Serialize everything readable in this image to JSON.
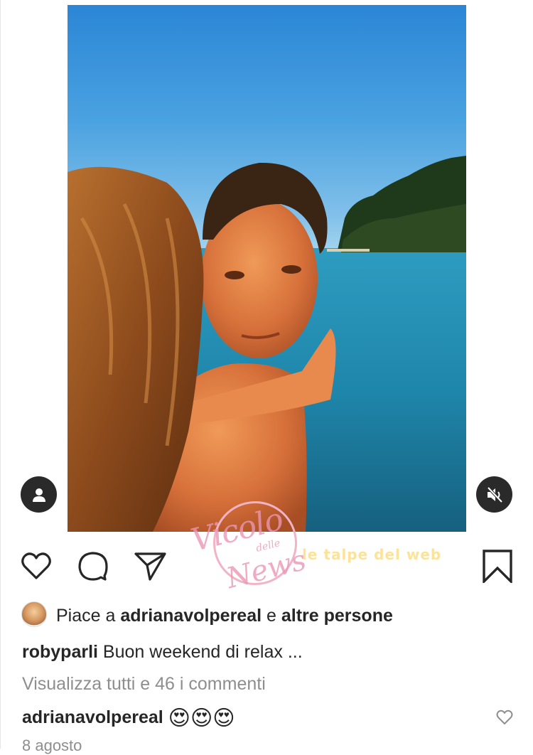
{
  "post": {
    "likes": {
      "prefix": "Piace a ",
      "user": "adrianavolpereal",
      "conj": " e ",
      "others": "altre persone"
    },
    "caption": {
      "user": "robyparli",
      "text": " Buon weekend di relax ..."
    },
    "view_all_comments": "Visualizza tutti e 46 i commenti",
    "top_comment": {
      "user": "adrianavolpereal",
      "text": "😍😍😍"
    },
    "date": "8 agosto"
  },
  "watermarks": {
    "logo_title": "Vicolo",
    "logo_sub": "delle",
    "logo_word": "News",
    "secondary": "le talpe del web"
  },
  "icons": {
    "tag": "person-icon",
    "mute": "speaker-muted-icon",
    "like": "heart-icon",
    "comment": "comment-bubble-icon",
    "share": "paper-plane-icon",
    "save": "bookmark-icon"
  },
  "colors": {
    "text": "#262626",
    "secondary_text": "#8e8e8e",
    "overlay_button": "#2a2a2a",
    "watermark_pink": "#ea96b4"
  }
}
